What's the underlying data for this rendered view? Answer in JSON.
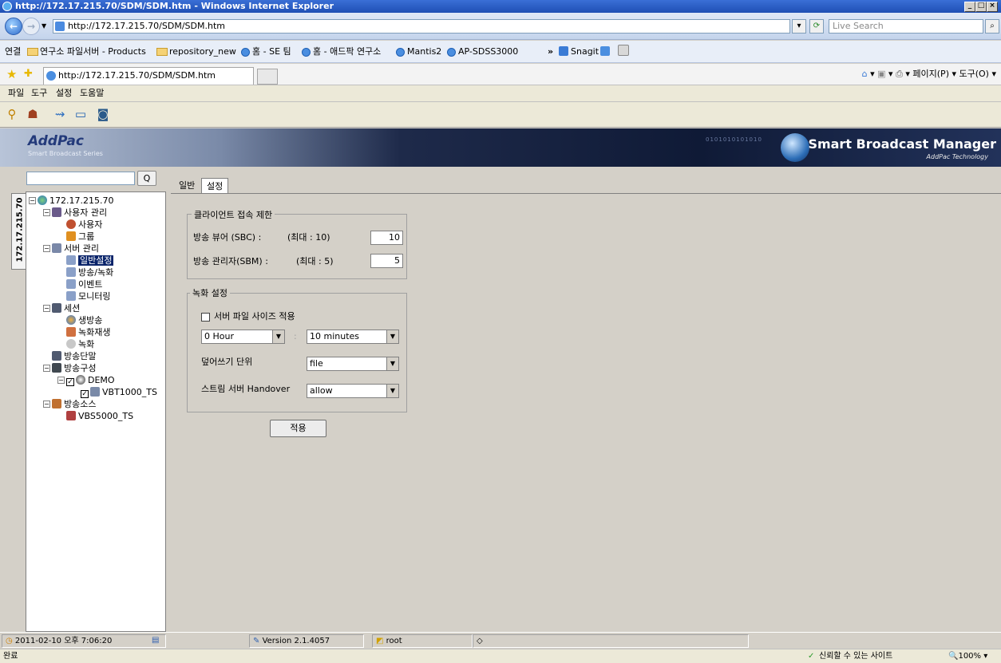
{
  "window": {
    "title": "http://172.17.215.70/SDM/SDM.htm - Windows Internet Explorer",
    "min": "_",
    "max": "□",
    "close": "×"
  },
  "address": {
    "url": "http://172.17.215.70/SDM/SDM.htm",
    "search_placeholder": "Live Search"
  },
  "links": {
    "label": "연결",
    "items": [
      "연구소 파일서버 - Products",
      "repository_new",
      "홈 - SE 팀",
      "홈 - 애드팍 연구소",
      "Mantis2",
      "AP-SDSS3000"
    ],
    "more": "»",
    "snagit": "Snagit"
  },
  "tabs": {
    "active": "http://172.17.215.70/SDM/SDM.htm",
    "commands": "페이지(P) ▾  도구(O) ▾"
  },
  "app_menu": [
    "파일",
    "도구",
    "설정",
    "도움말"
  ],
  "banner": {
    "logo": "AddPac",
    "logo_sub": "Smart Broadcast Series",
    "product": "Smart Broadcast Manager",
    "product_sub": "AddPac Technology",
    "digits": "0101010101010"
  },
  "left": {
    "vertical_tab": "172.17.215.70",
    "search_button": "Q",
    "tree": {
      "root": "172.17.215.70",
      "user_mgmt": "사용자 관리",
      "user": "사용자",
      "group": "그룹",
      "server_mgmt": "서버 관리",
      "general": "일반설정",
      "broadcast_rec": "방송/녹화",
      "event": "이벤트",
      "monitoring": "모니터링",
      "session": "세션",
      "live": "생방송",
      "playback": "녹화재생",
      "record": "녹화",
      "terminal": "방송단말",
      "config": "방송구성",
      "demo": "DEMO",
      "vbt": "VBT1000_TS",
      "source": "방송소스",
      "vbs": "VBS5000_TS"
    }
  },
  "content": {
    "tabs": [
      "일반",
      "설정"
    ],
    "client_limit": {
      "legend": "클라이언트 접속 제한",
      "sbc_label": "방송 뷰어 (SBC) :",
      "sbc_max": "(최대 : 10)",
      "sbc_value": "10",
      "sbm_label": "방송 관리자(SBM) :",
      "sbm_max": "(최대 : 5)",
      "sbm_value": "5"
    },
    "rec_settings": {
      "legend": "녹화 설정",
      "filesize_label": "서버 파일 사이즈 적용",
      "filesize_checked": false,
      "hour": "0 Hour",
      "colon": ":",
      "minutes": "10 minutes",
      "overwrite_label": "덮어쓰기 단위",
      "overwrite_value": "file",
      "handover_label": "스트림 서버 Handover",
      "handover_value": "allow"
    },
    "apply": "적용"
  },
  "status": {
    "datetime": "2011-02-10 오후 7:06:20",
    "version": "Version 2.1.4057",
    "user": "root"
  },
  "ie_status": {
    "left": "완료",
    "zone": "신뢰할 수 있는 사이트",
    "zoom": "100%"
  }
}
